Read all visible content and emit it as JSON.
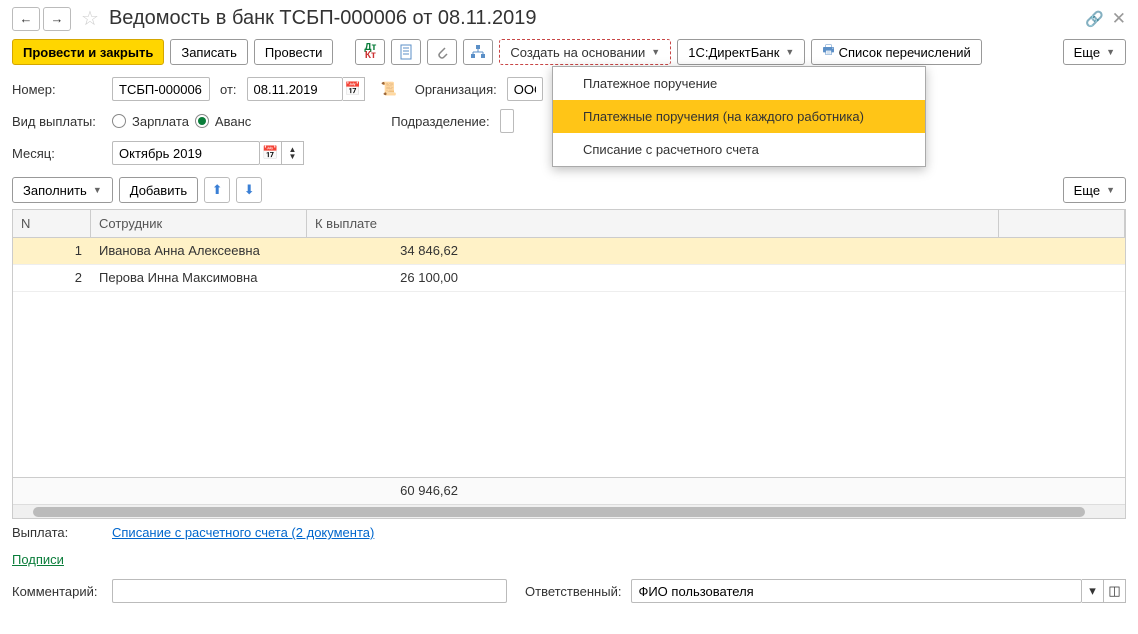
{
  "title": "Ведомость в банк ТСБП-000006 от 08.11.2019",
  "toolbar": {
    "post_close": "Провести и закрыть",
    "save": "Записать",
    "post": "Провести",
    "create_based": "Создать на основании",
    "direct_bank": "1С:ДиректБанк",
    "list_transfers": "Список перечислений",
    "more": "Еще"
  },
  "form": {
    "number_label": "Номер:",
    "number": "ТСБП-000006",
    "from_label": "от:",
    "date": "08.11.2019",
    "org_label": "Организация:",
    "org": "ООО",
    "pay_type_label": "Вид выплаты:",
    "salary": "Зарплата",
    "advance": "Аванс",
    "dept_label": "Подразделение:",
    "month_label": "Месяц:",
    "month": "Октябрь 2019"
  },
  "table_toolbar": {
    "fill": "Заполнить",
    "add": "Добавить",
    "more": "Еще"
  },
  "table": {
    "headers": {
      "n": "N",
      "emp": "Сотрудник",
      "pay": "К выплате"
    },
    "rows": [
      {
        "n": "1",
        "emp": "Иванова Анна Алексеевна",
        "pay": "34 846,62"
      },
      {
        "n": "2",
        "emp": "Перова Инна Максимовна",
        "pay": "26 100,00"
      }
    ],
    "total": "60 946,62"
  },
  "footer": {
    "payout_label": "Выплата:",
    "payout_link": "Списание с расчетного счета (2 документа)",
    "signatures": "Подписи",
    "comment_label": "Комментарий:",
    "responsible_label": "Ответственный:",
    "responsible": "ФИО пользователя"
  },
  "menu": {
    "item1": "Платежное поручение",
    "item2": "Платежные поручения (на каждого работника)",
    "item3": "Списание с расчетного счета"
  }
}
